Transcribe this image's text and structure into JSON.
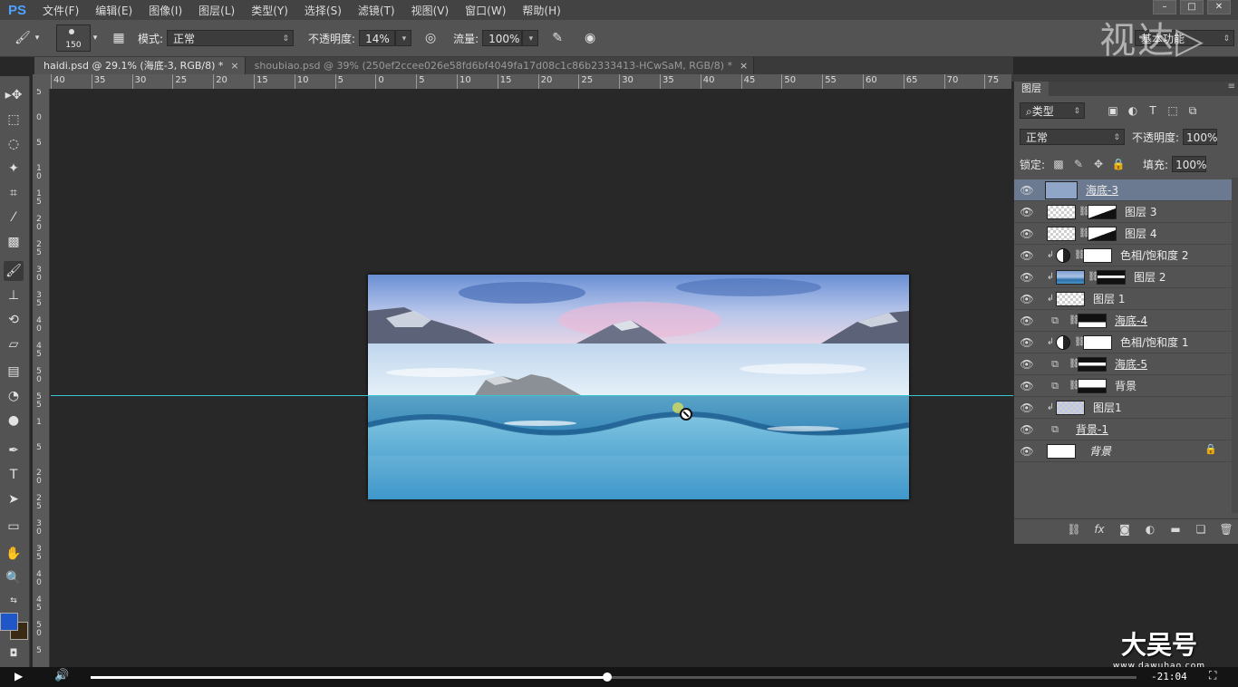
{
  "menubar": {
    "logo": "PS",
    "items": [
      "文件(F)",
      "编辑(E)",
      "图像(I)",
      "图层(L)",
      "类型(Y)",
      "选择(S)",
      "滤镜(T)",
      "视图(V)",
      "窗口(W)",
      "帮助(H)"
    ]
  },
  "options": {
    "brush_size": "150",
    "mode_label": "模式:",
    "mode_value": "正常",
    "opacity_label": "不透明度:",
    "opacity_value": "14%",
    "flow_label": "流量:",
    "flow_value": "100%",
    "workspace": "基本功能"
  },
  "watermark": {
    "top": "视达",
    "bottom_big": "大吴号",
    "bottom_small": "www.dawuhao.com"
  },
  "tabs": [
    {
      "label": "haidi.psd @ 29.1% (海底-3, RGB/8) *",
      "active": true
    },
    {
      "label": "shoubiao.psd @ 39% (250ef2ccee026e58fd6bf4049fa17d08c1c86b2333413-HCwSaM, RGB/8) *",
      "active": false
    }
  ],
  "ruler": {
    "h_ticks": [
      "40",
      "35",
      "30",
      "25",
      "20",
      "15",
      "10",
      "5",
      "0",
      "5",
      "10",
      "15",
      "20",
      "25",
      "30",
      "35",
      "40",
      "45",
      "50",
      "55",
      "60",
      "65",
      "70",
      "75"
    ],
    "v_ticks": [
      "5",
      "0",
      "5",
      "1\n0",
      "1\n5",
      "2\n0",
      "2\n5",
      "3\n0",
      "3\n5",
      "4\n0",
      "4\n5",
      "5\n0",
      "5\n5",
      "1",
      "5",
      "2\n0",
      "2\n5",
      "3\n0",
      "3\n5",
      "4\n0",
      "4\n5",
      "5\n0",
      "5"
    ]
  },
  "layers_panel": {
    "tab": "图层",
    "filter": "类型",
    "blend": "正常",
    "opacity_label": "不透明度:",
    "opacity_value": "100%",
    "lock_label": "锁定:",
    "fill_label": "填充:",
    "fill_value": "100%",
    "layers": [
      {
        "name": "海底-3",
        "selected": true
      },
      {
        "name": "图层 3"
      },
      {
        "name": "图层 4"
      },
      {
        "name": "色相/饱和度 2"
      },
      {
        "name": "图层 2"
      },
      {
        "name": "图层 1"
      },
      {
        "name": "海底-4"
      },
      {
        "name": "色相/饱和度 1"
      },
      {
        "name": "海底-5"
      },
      {
        "name": "背景"
      },
      {
        "name": "图层1"
      },
      {
        "name": "背景-1"
      },
      {
        "name": "背景"
      }
    ]
  },
  "video": {
    "timecode": "-21:04",
    "progress": 0.494
  }
}
